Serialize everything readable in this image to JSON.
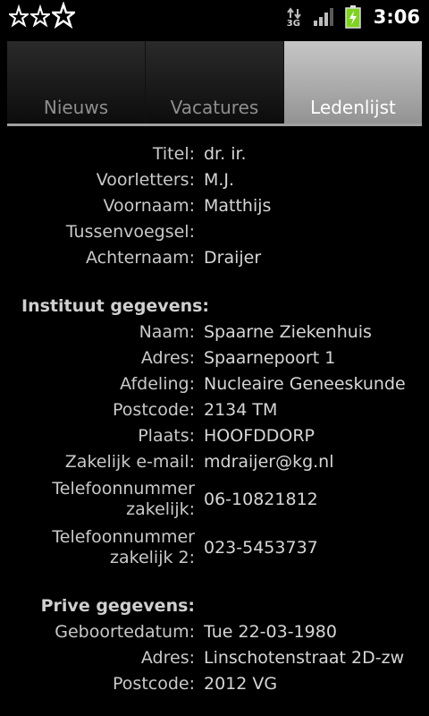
{
  "status_bar": {
    "time": "3:06",
    "network": "3G",
    "icons": [
      "star-icon",
      "star-icon",
      "star-icon",
      "network-3g-icon",
      "signal-icon",
      "battery-charging-icon"
    ]
  },
  "tabs": [
    {
      "label": "Nieuws",
      "active": false
    },
    {
      "label": "Vacatures",
      "active": false
    },
    {
      "label": "Ledenlijst",
      "active": true
    }
  ],
  "person": {
    "titel_label": "Titel:",
    "titel": "dr. ir.",
    "voorletters_label": "Voorletters:",
    "voorletters": "M.J.",
    "voornaam_label": "Voornaam:",
    "voornaam": "Matthijs",
    "tussenvoegsel_label": "Tussenvoegsel:",
    "tussenvoegsel": "",
    "achternaam_label": "Achternaam:",
    "achternaam": "Draijer"
  },
  "instituut": {
    "heading": "Instituut gegevens:",
    "naam_label": "Naam:",
    "naam": "Spaarne Ziekenhuis",
    "adres_label": "Adres:",
    "adres": "Spaarnepoort 1",
    "afdeling_label": "Afdeling:",
    "afdeling": "Nucleaire Geneeskunde",
    "postcode_label": "Postcode:",
    "postcode": "2134 TM",
    "plaats_label": "Plaats:",
    "plaats": "HOOFDDORP",
    "email_label": "Zakelijk e-mail:",
    "email": "mdraijer@kg.nl",
    "tel_label_1": "Telefoonnummer",
    "tel_label_2": "zakelijk:",
    "tel": "06-10821812",
    "tel2_label_1": "Telefoonnummer",
    "tel2_label_2": "zakelijk 2:",
    "tel2": "023-5453737"
  },
  "prive": {
    "heading": "Prive gegevens:",
    "geboortedatum_label": "Geboortedatum:",
    "geboortedatum": "Tue 22-03-1980",
    "adres_label": "Adres:",
    "adres": "Linschotenstraat 2D-zw",
    "postcode_label": "Postcode:",
    "postcode": "2012 VG"
  },
  "colors": {
    "background": "#000000",
    "active_tab": "#a8a8a8",
    "text": "#d6d6d6",
    "battery": "#7ed321"
  }
}
